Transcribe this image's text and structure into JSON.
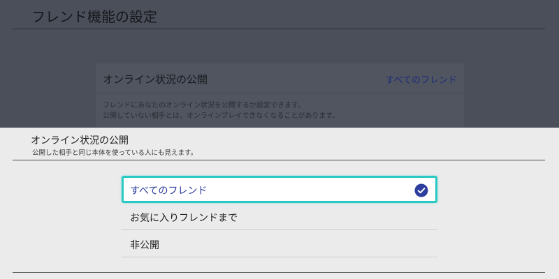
{
  "background": {
    "page_title": "フレンド機能の設定",
    "setting": {
      "label": "オンライン状況の公開",
      "value": "すべてのフレンド",
      "description_line1": "フレンドにあなたのオンライン状況を公開するか設定できます。",
      "description_line2": "公開していない相手とは、オンラインプレイできなくなることがあります。"
    }
  },
  "sheet": {
    "title": "オンライン状況の公開",
    "subtitle": "公開した相手と同じ本体を使っている人にも見えます。",
    "options": [
      {
        "label": "すべてのフレンド",
        "selected": true
      },
      {
        "label": "お気に入りフレンドまで",
        "selected": false
      },
      {
        "label": "非公開",
        "selected": false
      }
    ]
  },
  "colors": {
    "accent": "#2c3d9e",
    "focus_border": "#2bc9c4",
    "sheet_background": "#ebebeb",
    "dim_background": "#4b4f59"
  },
  "icons": {
    "selected_marker": "check-circle-icon"
  }
}
